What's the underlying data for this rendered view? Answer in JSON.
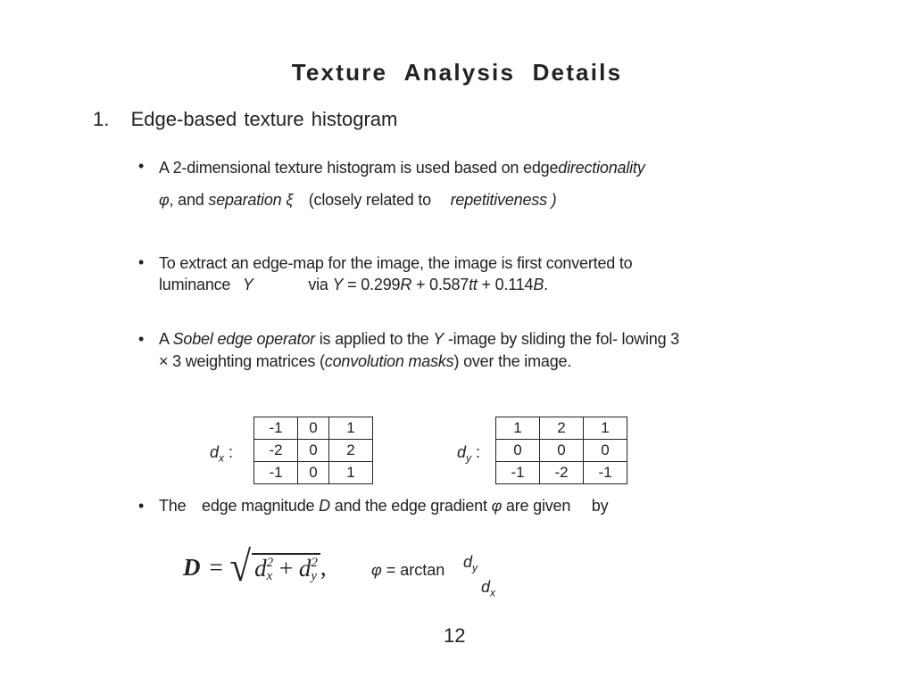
{
  "title": "Texture Analysis Details",
  "section": {
    "number": "1.",
    "heading": "Edge-based texture histogram"
  },
  "bullet_char": "•",
  "bullets": [
    {
      "line1": {
        "a": "A 2-dimensional texture histogram is used based on edge",
        "b_italic": "directionality"
      },
      "line2": {
        "a_italic": "φ",
        "b": ", and ",
        "c_italic": "separation ξ",
        "d": "(closely related to",
        "e_italic": "repetitiveness )"
      }
    },
    {
      "line1": {
        "a": "To extract an edge-map for the image, the image is first converted to"
      },
      "line2": {
        "a": "luminance",
        "b_italic": "Y",
        "c": "via",
        "d_italic": "Y",
        "e": " = 0.299",
        "f_italic": "R",
        "g": " + 0.587",
        "h_italic": "tt",
        "i": " + 0.114",
        "j_italic": "B",
        "k": "."
      }
    },
    {
      "line1": {
        "a": "A ",
        "b_italic": "Sobel edge operator",
        "c": " is applied to the ",
        "d_italic": "Y",
        "e": " -image by sliding the fol- lowing 3"
      },
      "line2": {
        "a": "× 3 weighting matrices (",
        "b_italic": "convolution masks",
        "c": ") over the image."
      }
    },
    {
      "line1": {
        "a": "The",
        "b": "edge magnitude",
        "c_italic": "D",
        "d": "and the edge gradient",
        "e_italic": "φ",
        "f": "are given",
        "g": "by"
      }
    }
  ],
  "matrices": {
    "dx": {
      "label": "d",
      "sub": "x",
      "suffix": " :",
      "rows": [
        [
          "-1",
          "0",
          "1"
        ],
        [
          "-2",
          "0",
          "2"
        ],
        [
          "-1",
          "0",
          "1"
        ]
      ]
    },
    "dy": {
      "label": "d",
      "sub": "y",
      "suffix": " :",
      "rows": [
        [
          "1",
          "2",
          "1"
        ],
        [
          "0",
          "0",
          "0"
        ],
        [
          "-1",
          "-2",
          "-1"
        ]
      ]
    }
  },
  "formulas": {
    "magnitude": {
      "lhs": "D",
      "eq": "=",
      "sqrt": "√",
      "t1": "d",
      "t1_sup": "2",
      "t1_sub": "x",
      "plus": " + ",
      "t2": "d",
      "t2_sup": "2",
      "t2_sub": "y",
      "comma": ","
    },
    "gradient": {
      "lhs": "φ",
      "rhs": " = arctan",
      "num": "d",
      "num_sub": "y",
      "den": "d",
      "den_sub": "x"
    }
  },
  "page_number": "12"
}
